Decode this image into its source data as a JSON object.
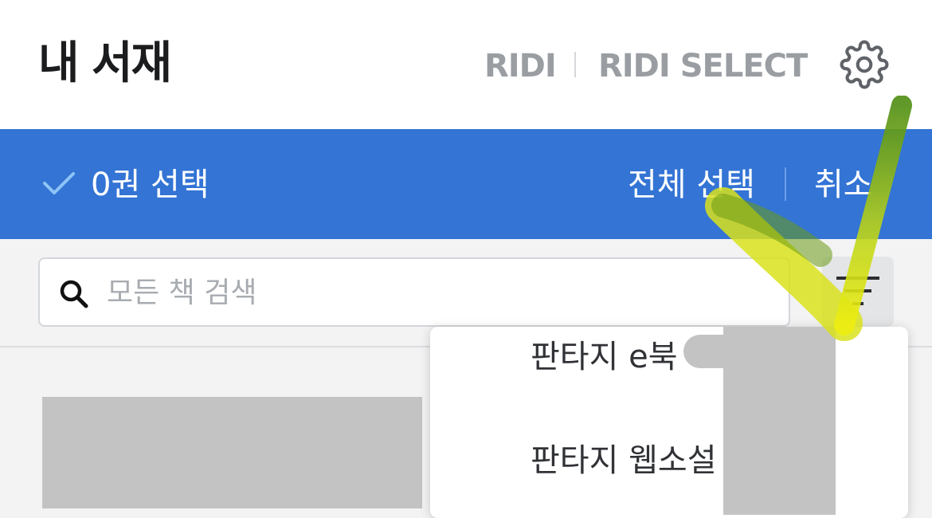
{
  "header": {
    "title": "내 서재",
    "brand_links": [
      "RIDI",
      "RIDI SELECT"
    ],
    "settings_icon": "gear-icon"
  },
  "selection_bar": {
    "count_label": "0권 선택",
    "select_all_label": "전체 선택",
    "cancel_label": "취소",
    "bar_color": "#3374d5"
  },
  "search": {
    "placeholder": "모든 책 검색",
    "value": "",
    "icon": "search-icon"
  },
  "filter": {
    "icon": "filter-icon"
  },
  "filter_menu": {
    "items": [
      "판타지 e북",
      "판타지 웹소설"
    ]
  }
}
